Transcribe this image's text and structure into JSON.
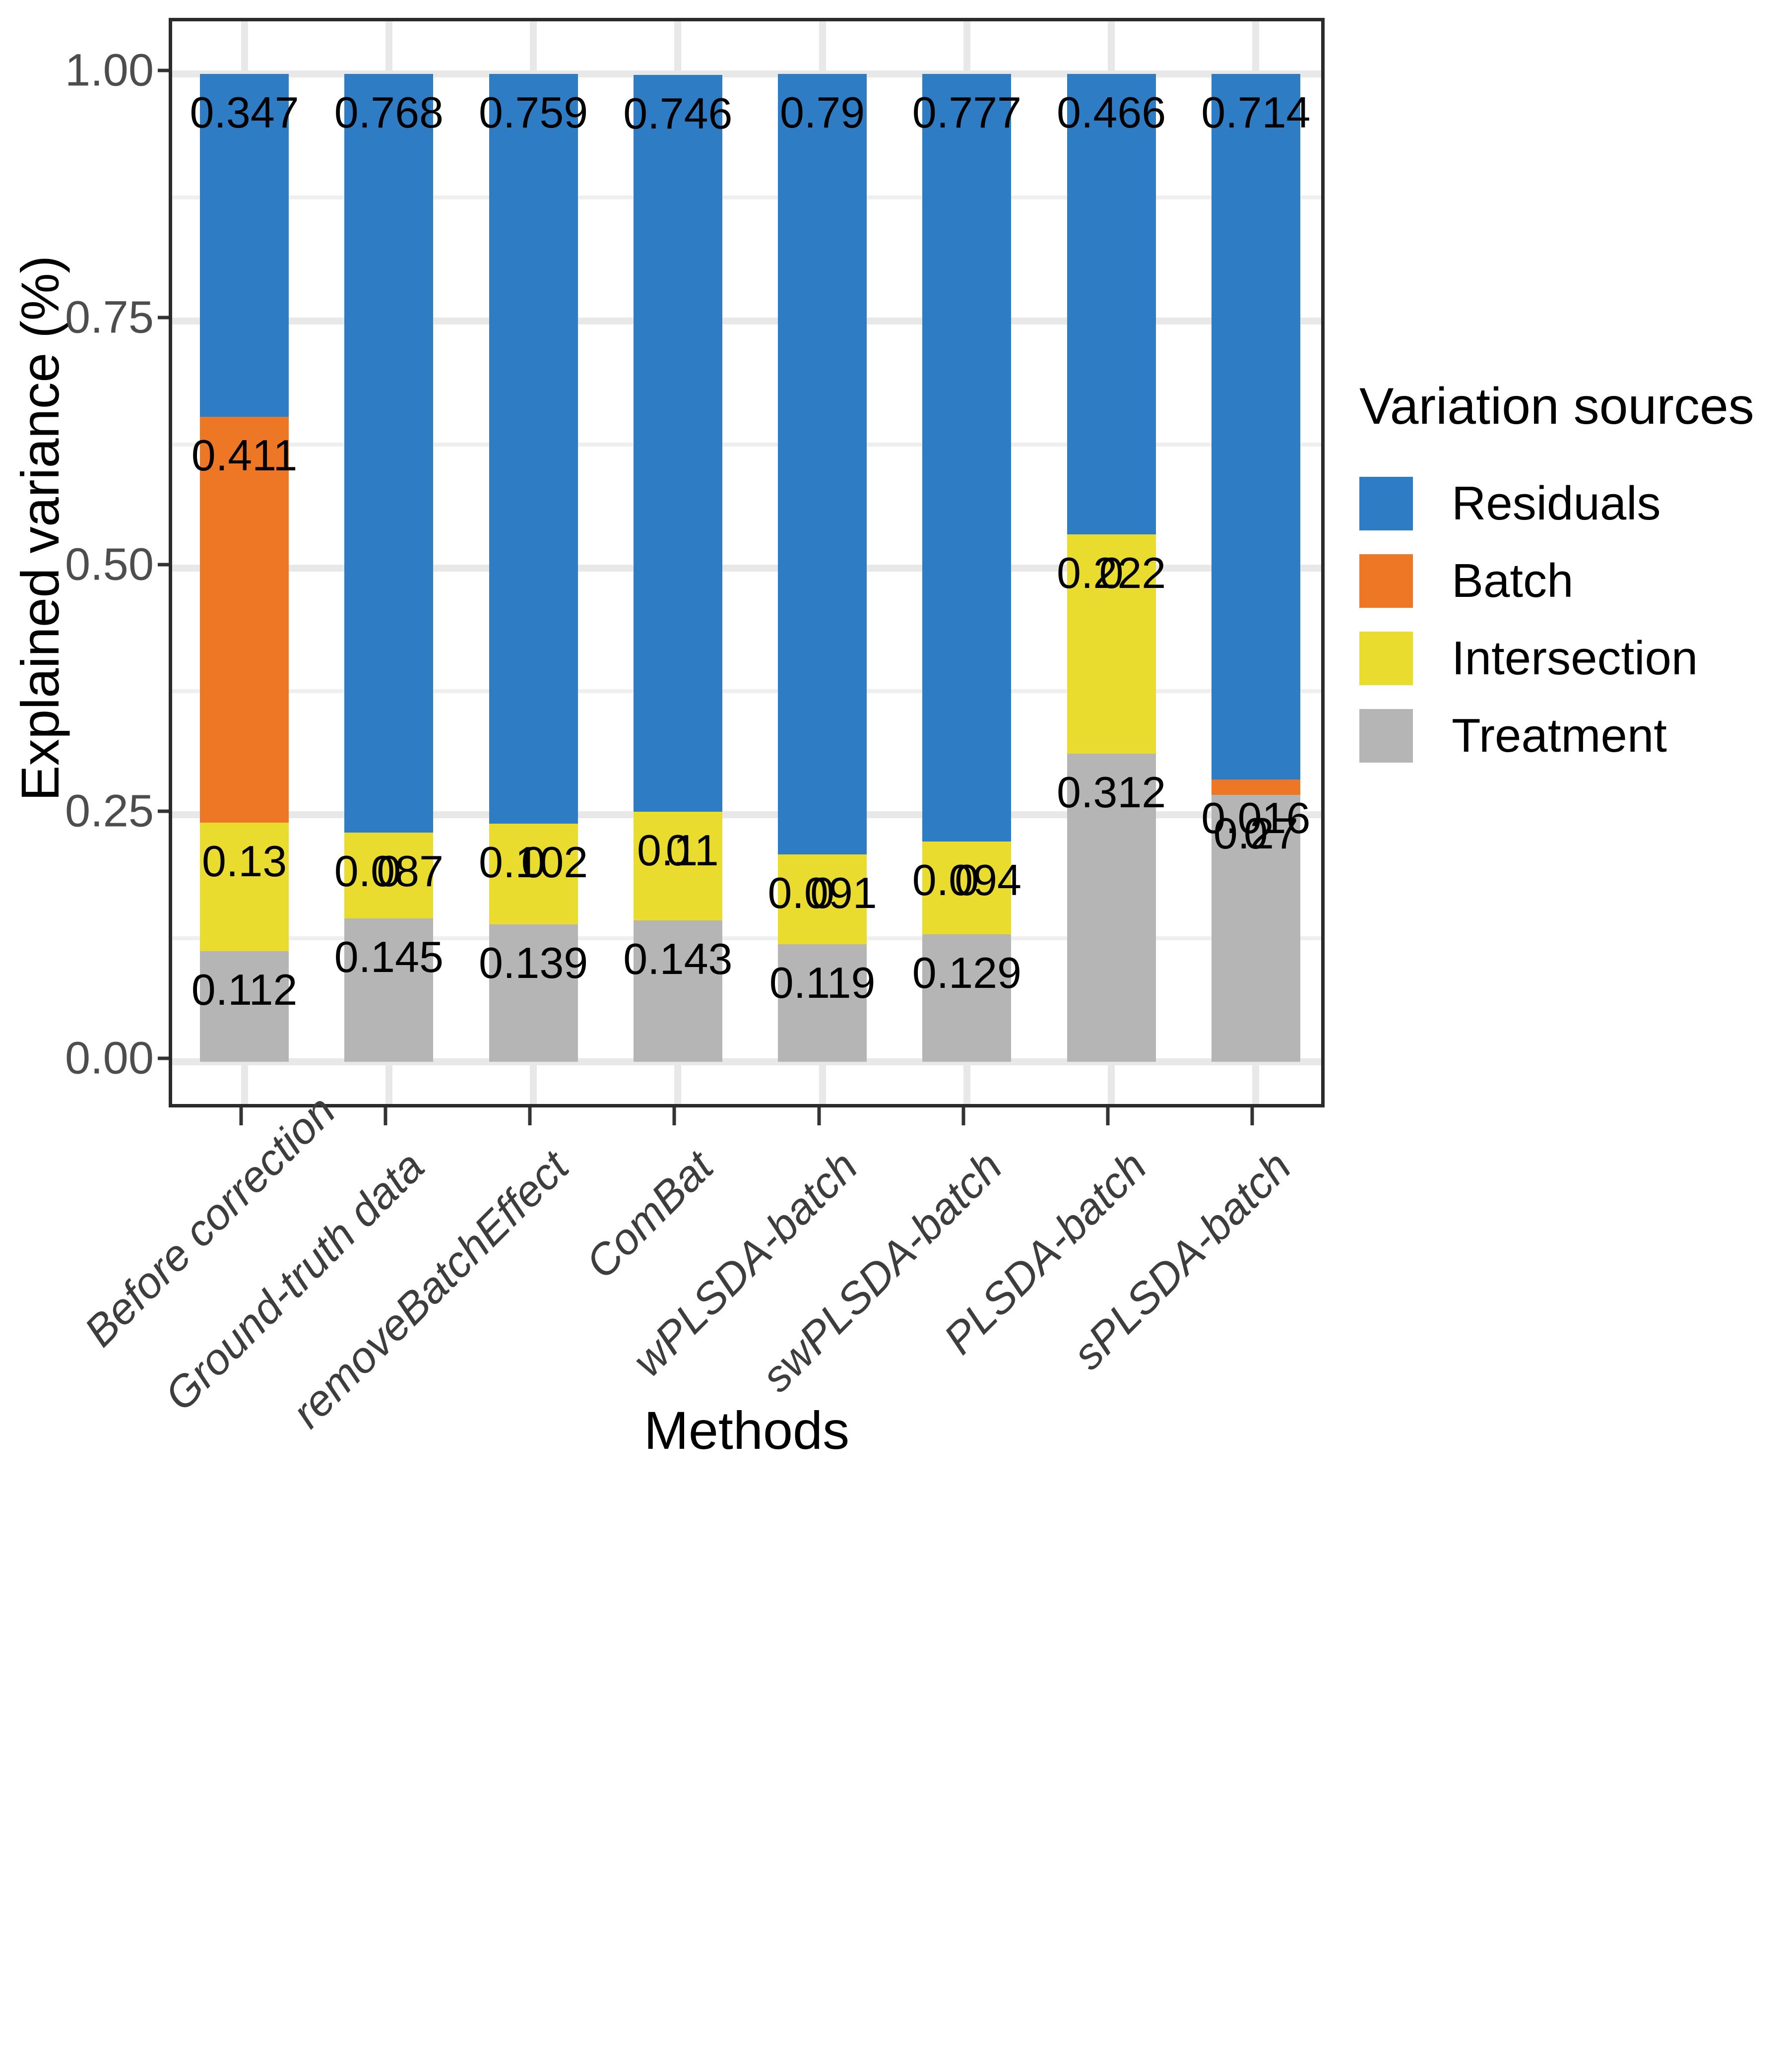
{
  "chart_data": {
    "type": "bar",
    "subtype": "stacked-bar-100",
    "title": "",
    "xlabel": "Methods",
    "ylabel": "Explained variance (%)",
    "ylim": [
      0.0,
      1.0
    ],
    "ytick_labels": [
      "0.00",
      "0.25",
      "0.50",
      "0.75",
      "1.00"
    ],
    "ytick_values": [
      0.0,
      0.25,
      0.5,
      0.75,
      1.0
    ],
    "grid": true,
    "legend_position": "right",
    "legend_title": "Variation sources",
    "categories": [
      "Before correction",
      "Ground-truth data",
      "removeBatchEffect",
      "ComBat",
      "wPLSDA-batch",
      "swPLSDA-batch",
      "PLSDA-batch",
      "sPLSDA-batch"
    ],
    "series": [
      {
        "name": "Treatment",
        "color": "#b5b5b5",
        "values": [
          0.112,
          0.145,
          0.139,
          0.143,
          0.119,
          0.129,
          0.312,
          0.27
        ],
        "labels": [
          "0.112",
          "0.145",
          "0.139",
          "0.143",
          "0.119",
          "0.129",
          "0.312",
          "0.27"
        ]
      },
      {
        "name": "Intersection",
        "color": "#eadc2e",
        "values": [
          0.13,
          0.087,
          0.102,
          0.11,
          0.091,
          0.094,
          0.222,
          0
        ],
        "labels": [
          "0.13",
          "0.087",
          "0.102",
          "0.11",
          "0.091",
          "0.094",
          "0.222",
          "0"
        ]
      },
      {
        "name": "Batch",
        "color": "#ed7724",
        "values": [
          0.411,
          0,
          0,
          0,
          0,
          0,
          0,
          0.016
        ],
        "labels": [
          "0.411",
          "0",
          "0",
          "0",
          "0",
          "0",
          "0",
          "0.016"
        ]
      },
      {
        "name": "Residuals",
        "color": "#2e7cc3",
        "values": [
          0.347,
          0.768,
          0.759,
          0.746,
          0.79,
          0.777,
          0.466,
          0.714
        ],
        "labels": [
          "0.347",
          "0.768",
          "0.759",
          "0.746",
          "0.79",
          "0.777",
          "0.466",
          "0.714"
        ]
      }
    ]
  },
  "legend": {
    "title": "Variation sources",
    "items": [
      {
        "label": "Residuals",
        "color": "#2e7cc3"
      },
      {
        "label": "Batch",
        "color": "#ed7724"
      },
      {
        "label": "Intersection",
        "color": "#eadc2e"
      },
      {
        "label": "Treatment",
        "color": "#b5b5b5"
      }
    ]
  },
  "axes": {
    "x_title": "Methods",
    "y_title": "Explained variance (%)"
  }
}
